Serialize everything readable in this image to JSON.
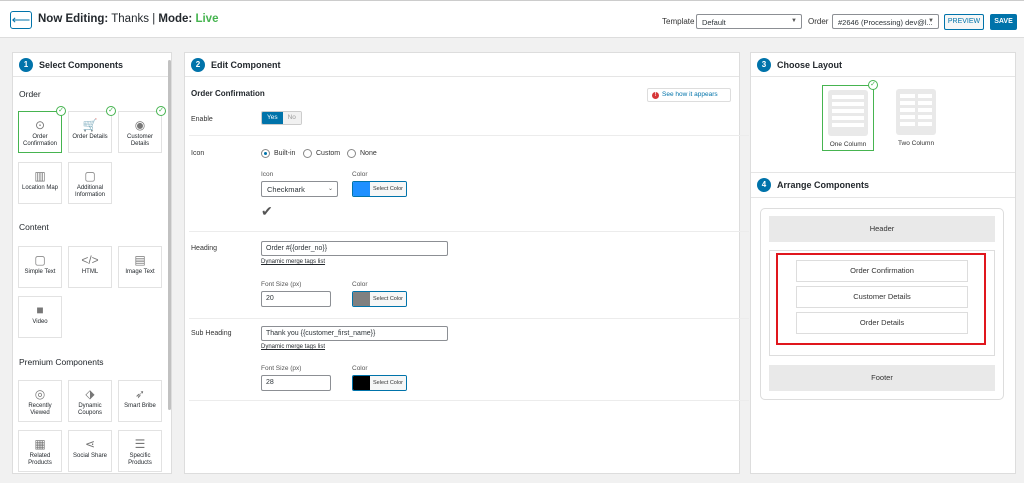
{
  "header": {
    "back_icon": "arrow-left-icon",
    "title_prefix": "Now Editing:",
    "title_name": "Thanks",
    "separator": "|",
    "mode_label": "Mode:",
    "mode_value": "Live",
    "template_label": "Template",
    "template_value": "Default",
    "order_label": "Order",
    "order_value": "#2646 (Processing) dev@l...",
    "preview_label": "PREVIEW",
    "save_label": "SAVE"
  },
  "components": {
    "step": "1",
    "title": "Select Components",
    "sections": {
      "order": "Order",
      "content": "Content",
      "premium": "Premium Components"
    },
    "order_items": [
      {
        "label": "Order Confirmation",
        "icon": "check-circle-icon"
      },
      {
        "label": "Order Details",
        "icon": "cart-icon"
      },
      {
        "label": "Customer Details",
        "icon": "user-icon"
      },
      {
        "label": "Location Map",
        "icon": "map-icon"
      },
      {
        "label": "Additional Information",
        "icon": "note-icon"
      }
    ],
    "content_items": [
      {
        "label": "Simple Text",
        "icon": "note-icon"
      },
      {
        "label": "HTML",
        "icon": "code-icon"
      },
      {
        "label": "Image Text",
        "icon": "image-text-icon"
      },
      {
        "label": "Video",
        "icon": "video-icon"
      }
    ],
    "premium_items": [
      {
        "label": "Recently Viewed",
        "icon": "eye-icon"
      },
      {
        "label": "Dynamic Coupons",
        "icon": "tag-icon"
      },
      {
        "label": "Smart Bribe",
        "icon": "rocket-icon"
      },
      {
        "label": "Related Products",
        "icon": "grid-icon"
      },
      {
        "label": "Social Share",
        "icon": "share-icon"
      },
      {
        "label": "Specific Products",
        "icon": "list-icon"
      }
    ],
    "check_glyph": "✓"
  },
  "edit": {
    "step": "2",
    "title": "Edit Component",
    "component_name": "Order Confirmation",
    "see_how": "See how it appears",
    "enable_label": "Enable",
    "yes": "Yes",
    "no": "No",
    "icon_label": "Icon",
    "icon_options": [
      "Built-in",
      "Custom",
      "None"
    ],
    "icon_select_label": "Icon",
    "icon_select_value": "Checkmark",
    "color_label": "Color",
    "select_color": "Select Color",
    "icon_color": "#1e90ff",
    "check_preview": "✔",
    "heading_label": "Heading",
    "heading_value": "Order #{{order_no}}",
    "merge_tags": "Dynamic merge tags list",
    "font_size_label": "Font Size (px)",
    "heading_font_size": "20",
    "heading_color": "#808080",
    "subheading_label": "Sub Heading",
    "subheading_value": "Thank you {{customer_first_name}}",
    "subheading_font_size": "28",
    "subheading_color": "#000000"
  },
  "layout": {
    "step": "3",
    "title": "Choose Layout",
    "options": [
      "One Column",
      "Two Column"
    ]
  },
  "arrange": {
    "step": "4",
    "title": "Arrange Components",
    "header": "Header",
    "items": [
      "Order Confirmation",
      "Customer Details",
      "Order Details"
    ],
    "footer": "Footer"
  }
}
